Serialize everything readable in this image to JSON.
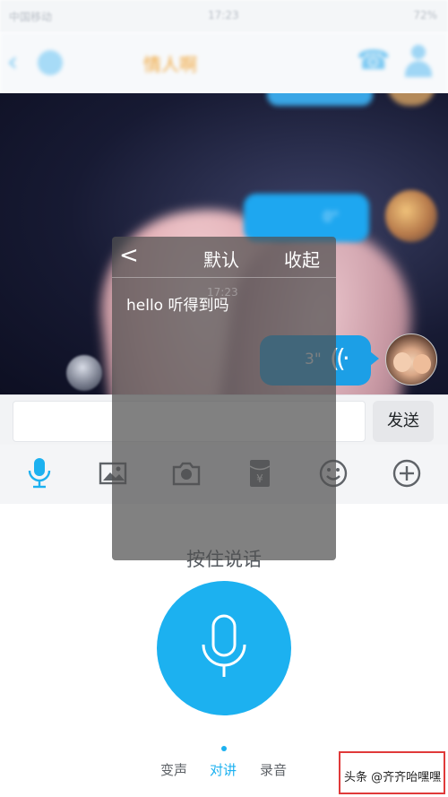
{
  "status_bar": {
    "left": "中国移动",
    "center": "17:23",
    "right": "72%"
  },
  "chat_header": {
    "contact_name": "情人啊"
  },
  "chat": {
    "voice_message": {
      "duration": "3\""
    },
    "blurred_bubble_text": "0\""
  },
  "input_bar": {
    "message_placeholder": "",
    "send_label": "发送"
  },
  "toolbar": {
    "icons": [
      "mic-icon",
      "image-icon",
      "camera-icon",
      "red-packet-icon",
      "emoji-icon",
      "plus-icon"
    ],
    "accent_color": "#1cb1f0"
  },
  "voice_panel": {
    "hold_to_talk": "按住说话",
    "modes": [
      "变声",
      "对讲",
      "录音"
    ],
    "active_mode": "对讲"
  },
  "overlay": {
    "back_symbol": "<",
    "default_label": "默认",
    "collapse_label": "收起",
    "timestamp": "17:23",
    "transcript": "hello 听得到吗"
  },
  "watermark": {
    "text": "头条 @齐齐咍嘿嘿"
  }
}
